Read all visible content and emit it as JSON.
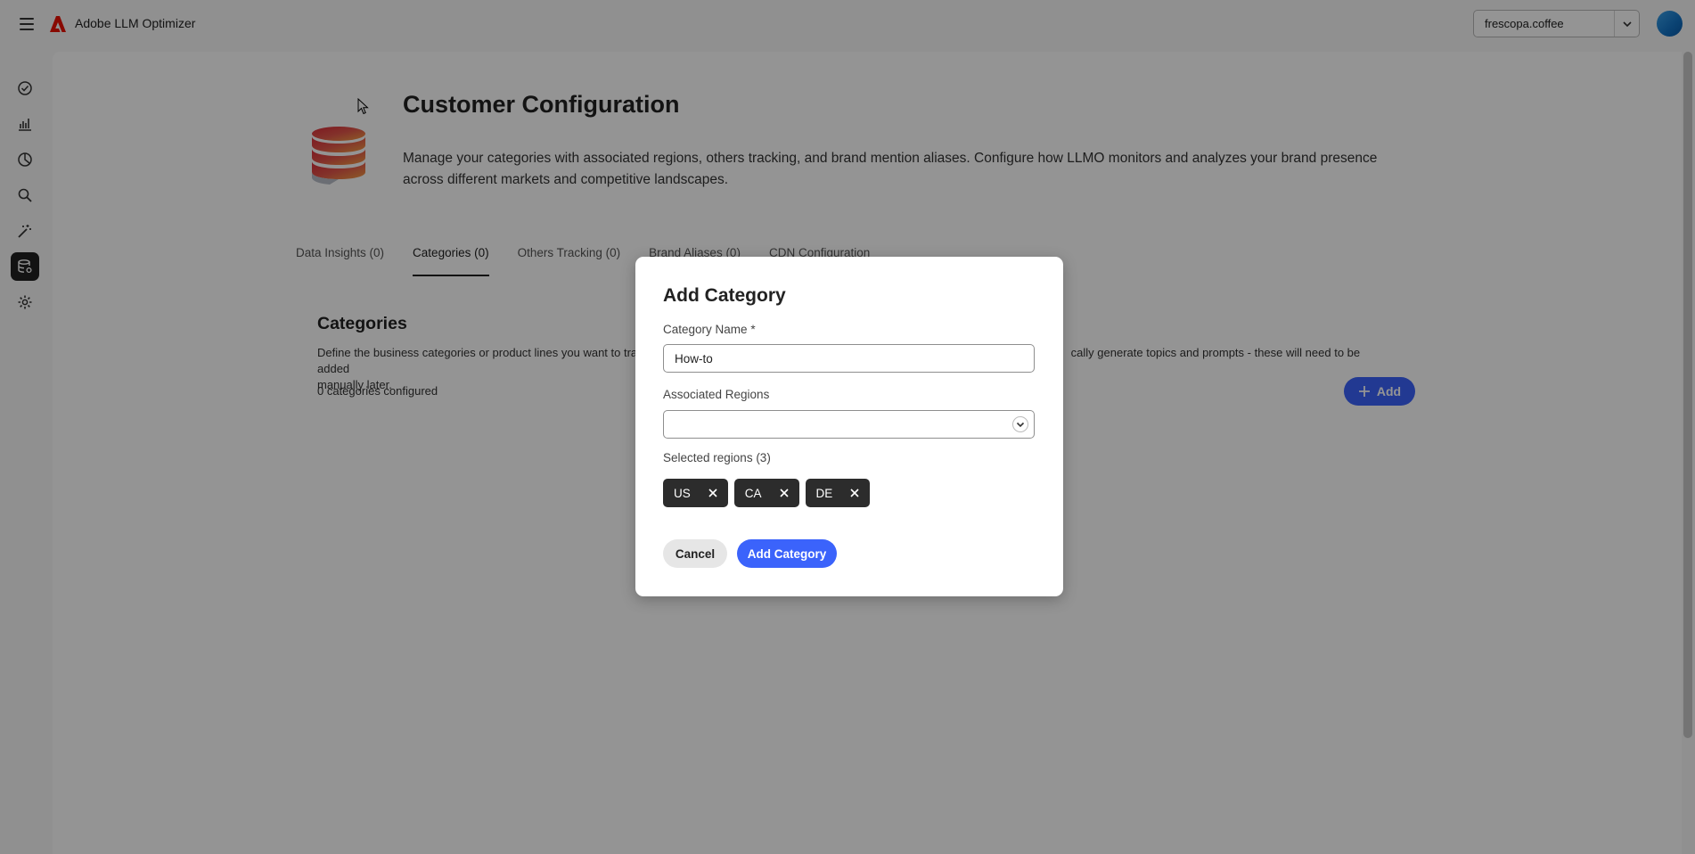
{
  "app": {
    "title": "Adobe LLM Optimizer",
    "org_selector": {
      "value": "frescopa.coffee"
    }
  },
  "rail": {
    "items": [
      {
        "icon": "check-circle-icon"
      },
      {
        "icon": "bar-chart-icon"
      },
      {
        "icon": "pie-chart-icon"
      },
      {
        "icon": "search-icon"
      },
      {
        "icon": "magic-wand-icon"
      },
      {
        "icon": "database-settings-icon",
        "active": true
      },
      {
        "icon": "gear-icon"
      }
    ]
  },
  "page": {
    "title": "Customer Configuration",
    "description": "Manage your categories with associated regions, others tracking, and brand mention aliases. Configure how LLMO monitors and analyzes your brand presence across different markets and competitive landscapes."
  },
  "tabs": [
    {
      "label": "Data Insights (0)"
    },
    {
      "label": "Categories (0)",
      "active": true
    },
    {
      "label": "Others Tracking (0)"
    },
    {
      "label": "Brand Aliases (0)"
    },
    {
      "label": "CDN Configuration"
    }
  ],
  "section": {
    "title": "Categories",
    "description_start": "Define the business categories or product lines you want to trac",
    "description_end": "cally generate topics and prompts - these will need to be added",
    "description_line2": "manually later.",
    "count_text": "0 categories configured",
    "add_label": "Add"
  },
  "dialog": {
    "title": "Add Category",
    "name_label": "Category Name",
    "name_required_mark": "*",
    "name_value": "How-to",
    "regions_label": "Associated Regions",
    "regions_value": "",
    "selected_label": "Selected regions (3)",
    "selected_regions": [
      "US",
      "CA",
      "DE"
    ],
    "cancel_label": "Cancel",
    "submit_label": "Add Category"
  },
  "colors": {
    "accent": "#3b63fb",
    "chip_bg": "#2c2c2c",
    "overlay": "rgba(0,0,0,0.42)",
    "adobe_red": "#eb1000"
  }
}
